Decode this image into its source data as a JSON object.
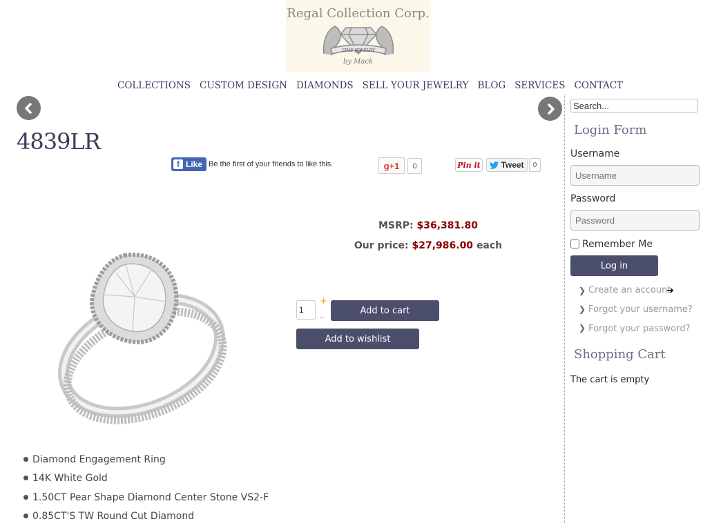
{
  "header": {
    "brand": "Regal Collection Corp.",
    "emblem_text": "FINE JEWELRY",
    "byline": "by Mack"
  },
  "nav": {
    "items": [
      "COLLECTIONS",
      "CUSTOM DESIGN",
      "DIAMONDS",
      "SELL YOUR JEWELRY",
      "BLOG",
      "SERVICES",
      "CONTACT"
    ]
  },
  "product": {
    "title": "4839LR",
    "msrp_label": "MSRP:",
    "msrp_value": "$36,381.80",
    "price_label": "Our price:",
    "price_value": "$27,986.00",
    "price_suffix": "each",
    "quantity": "1",
    "add_to_cart": "Add to cart",
    "add_to_wishlist": "Add to wishlist",
    "features": [
      "Diamond Engagement Ring",
      "14K White Gold",
      "1.50CT Pear Shape Diamond Center Stone VS2-F",
      "0.85CT'S TW Round Cut Diamond"
    ]
  },
  "social": {
    "fb_like": "Like",
    "fb_text": "Be the first of your friends to like this.",
    "gplus_label": "g+1",
    "gplus_count": "0",
    "pinit": "Pin it",
    "tweet": "Tweet",
    "tweet_count": "0"
  },
  "sidebar": {
    "search_value": "Search...",
    "login_title": "Login Form",
    "username_label": "Username",
    "username_placeholder": "Username",
    "password_label": "Password",
    "password_placeholder": "Password",
    "remember_label": "Remember Me",
    "login_button": "Log in",
    "links": [
      "Create an account",
      "Forgot your username?",
      "Forgot your password?"
    ],
    "cart_title": "Shopping Cart",
    "cart_status": "The cart is empty"
  },
  "colors": {
    "accent": "#4b4f6b",
    "price": "#8b0000",
    "nav_text": "#3b3f5e"
  }
}
